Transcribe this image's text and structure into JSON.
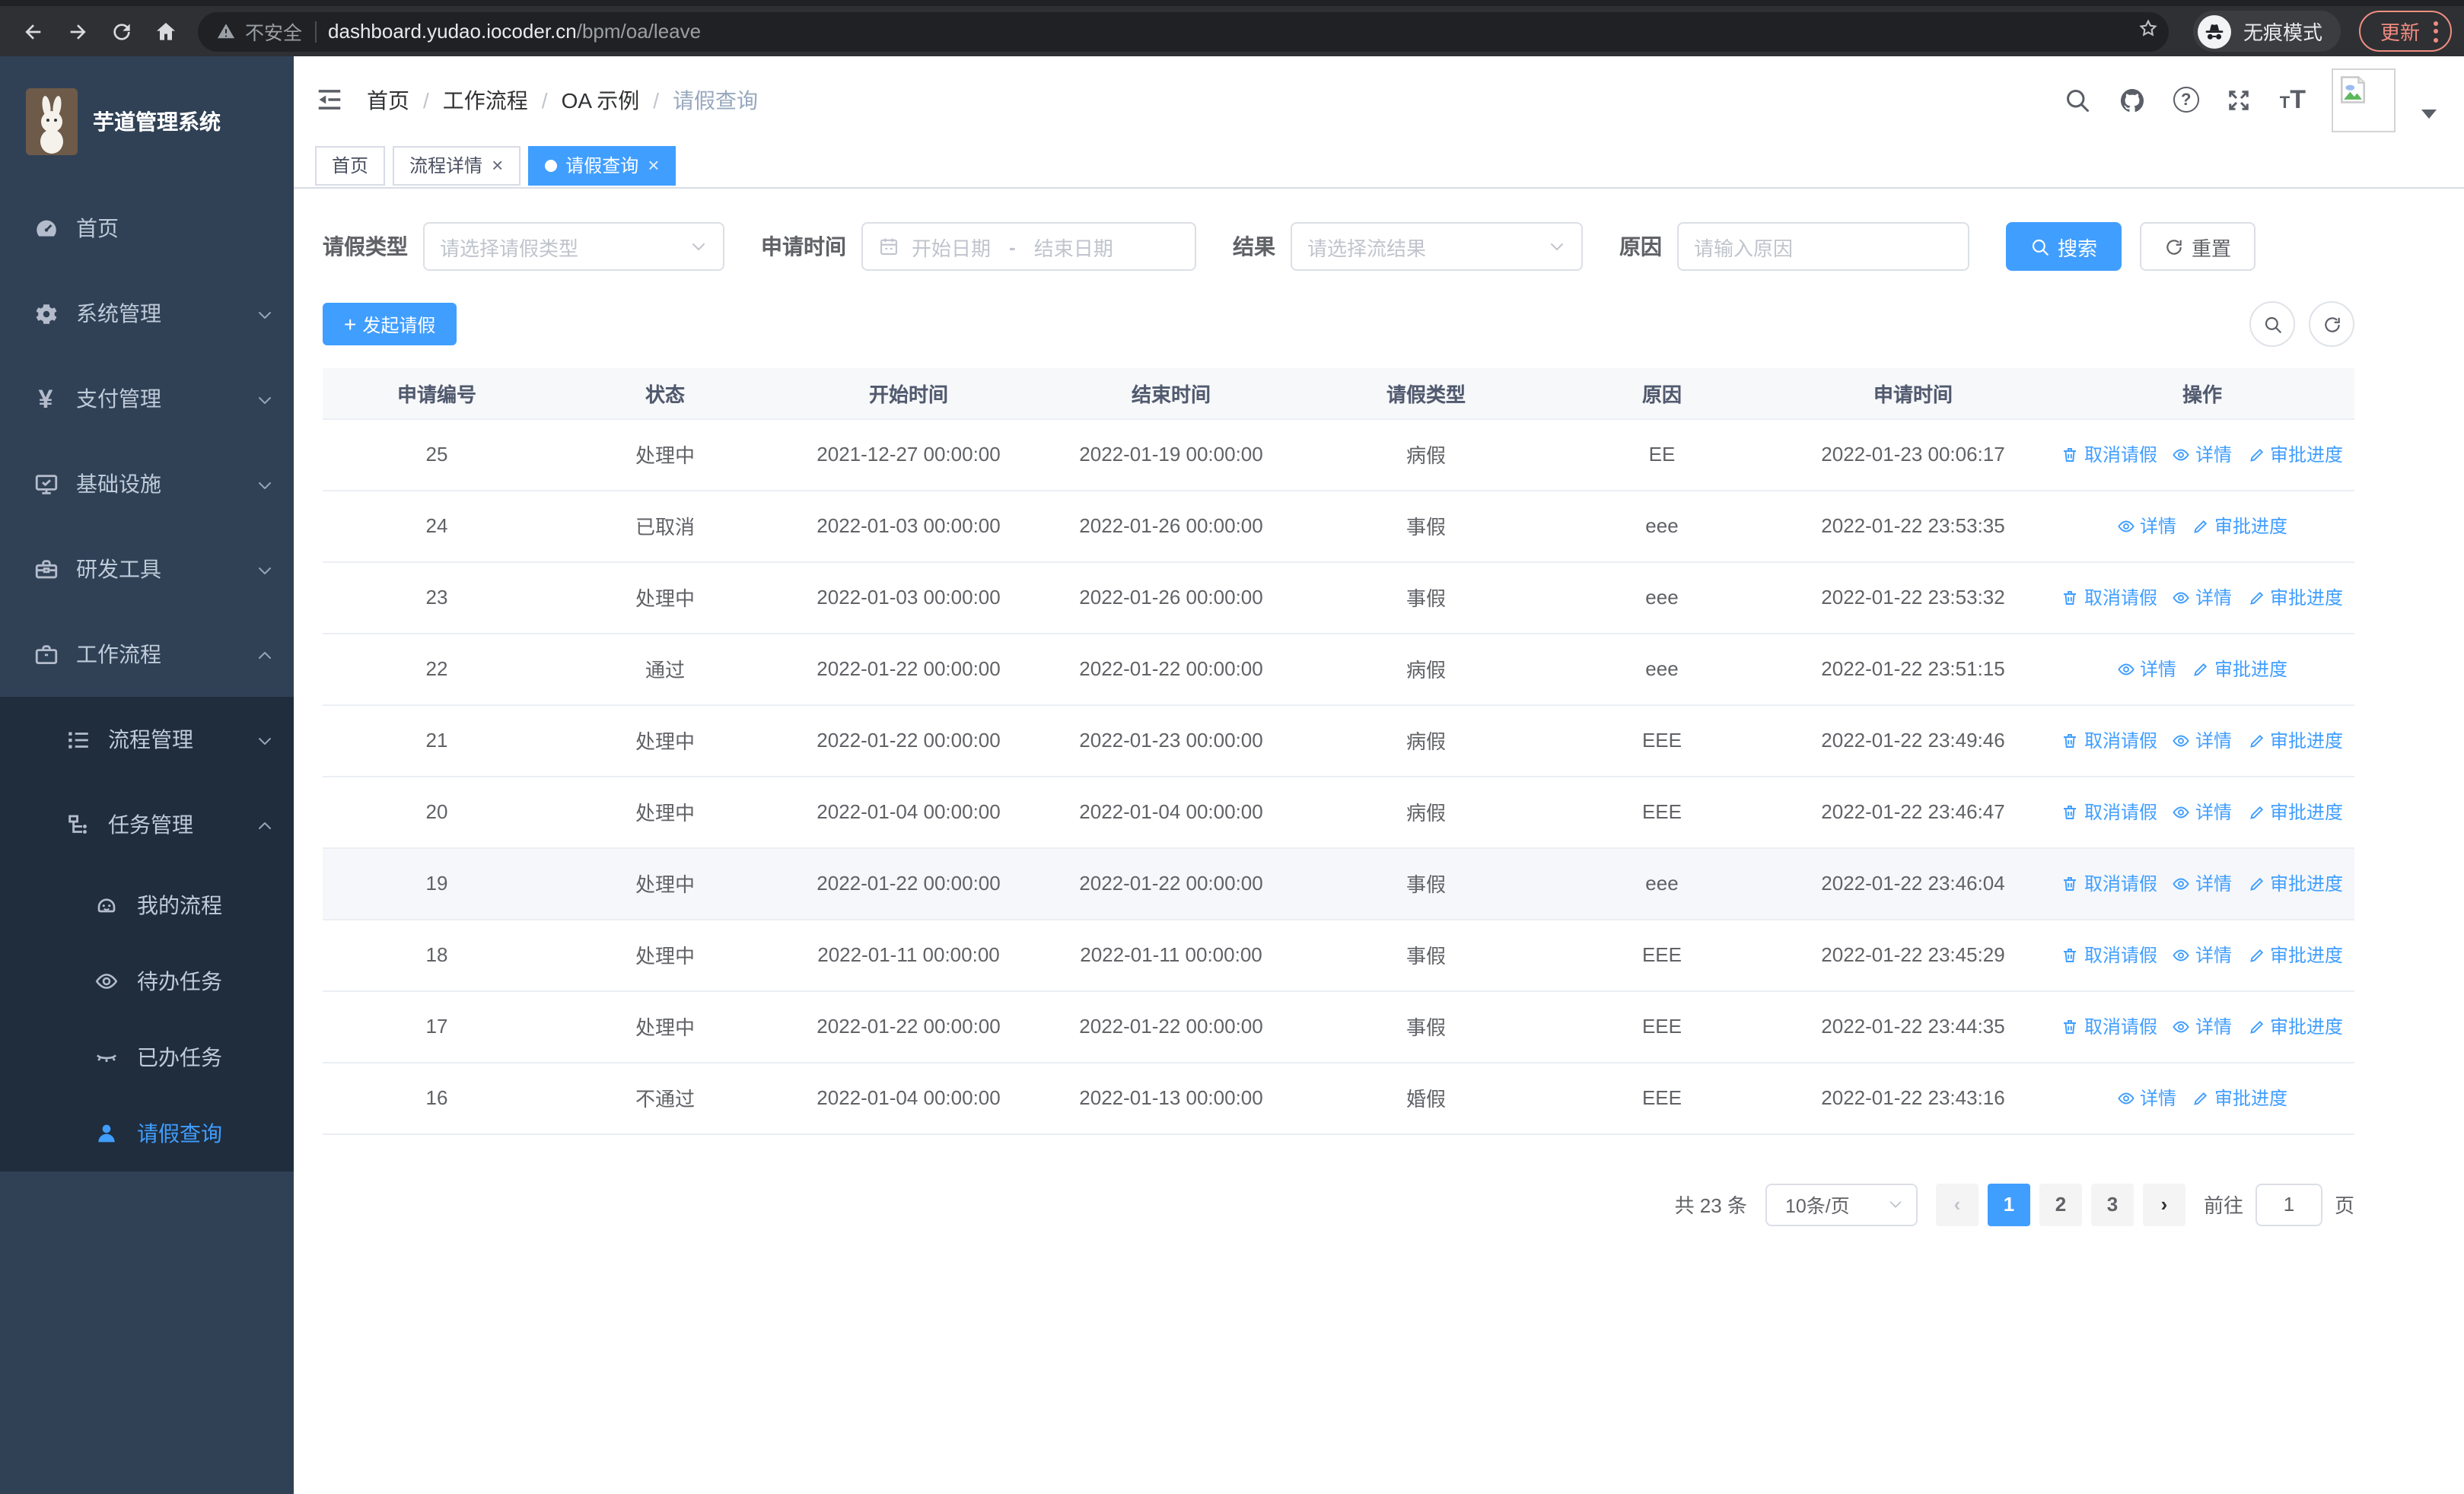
{
  "colors": {
    "primary": "#409EFF",
    "sidebar_bg": "#304156",
    "submenu_bg": "#1f2d3d",
    "update_accent": "#f28b82"
  },
  "browser": {
    "security_label": "不安全",
    "url_host": "dashboard.yudao.iocoder.cn",
    "url_path": "/bpm/oa/leave",
    "incognito_label": "无痕模式",
    "update_label": "更新"
  },
  "sidebar": {
    "app_title": "芋道管理系统",
    "menu": [
      {
        "label": "首页",
        "icon": "dashboard-icon"
      },
      {
        "label": "系统管理",
        "icon": "gear-icon",
        "chevron": "down"
      },
      {
        "label": "支付管理",
        "icon": "yen-icon",
        "chevron": "down"
      },
      {
        "label": "基础设施",
        "icon": "monitor-icon",
        "chevron": "down"
      },
      {
        "label": "研发工具",
        "icon": "toolbox-icon",
        "chevron": "down"
      },
      {
        "label": "工作流程",
        "icon": "briefcase-icon",
        "chevron": "up"
      }
    ],
    "submenu": [
      {
        "label": "流程管理",
        "icon": "list-tree-icon",
        "chevron": "down"
      },
      {
        "label": "任务管理",
        "icon": "flow-tree-icon",
        "chevron": "up"
      }
    ],
    "task_items": [
      {
        "label": "我的流程",
        "icon": "robot-icon"
      },
      {
        "label": "待办任务",
        "icon": "eye-icon"
      },
      {
        "label": "已办任务",
        "icon": "eye-closed-icon"
      },
      {
        "label": "请假查询",
        "icon": "user-icon",
        "active": true
      }
    ]
  },
  "header": {
    "breadcrumb": [
      "首页",
      "工作流程",
      "OA 示例",
      "请假查询"
    ],
    "separator": "/",
    "icons": [
      "search-icon",
      "github-icon",
      "help-icon",
      "fullscreen-icon",
      "font-size-icon",
      "avatar",
      "caret-down-icon"
    ]
  },
  "tabs": [
    {
      "label": "首页"
    },
    {
      "label": "流程详情",
      "close": "×"
    },
    {
      "label": "请假查询",
      "close": "×",
      "active": true
    }
  ],
  "filters": {
    "leave_type_label": "请假类型",
    "leave_type_placeholder": "请选择请假类型",
    "apply_time_label": "申请时间",
    "date_start_placeholder": "开始日期",
    "date_separator": "-",
    "date_end_placeholder": "结束日期",
    "result_label": "结果",
    "result_placeholder": "请选择流结果",
    "reason_label": "原因",
    "reason_placeholder": "请输入原因",
    "search_label": "搜索",
    "reset_label": "重置"
  },
  "toolbar": {
    "create_label": "发起请假"
  },
  "table": {
    "columns": [
      "申请编号",
      "状态",
      "开始时间",
      "结束时间",
      "请假类型",
      "原因",
      "申请时间",
      "操作"
    ],
    "rows": [
      {
        "id": "25",
        "status": "处理中",
        "start": "2021-12-27 00:00:00",
        "end": "2022-01-19 00:00:00",
        "type": "病假",
        "reason": "EE",
        "apply_time": "2022-01-23 00:06:17",
        "actions": {
          "cancel": "取消请假",
          "detail": "详情",
          "progress": "审批进度"
        }
      },
      {
        "id": "24",
        "status": "已取消",
        "start": "2022-01-03 00:00:00",
        "end": "2022-01-26 00:00:00",
        "type": "事假",
        "reason": "eee",
        "apply_time": "2022-01-22 23:53:35",
        "actions": {
          "detail": "详情",
          "progress": "审批进度"
        }
      },
      {
        "id": "23",
        "status": "处理中",
        "start": "2022-01-03 00:00:00",
        "end": "2022-01-26 00:00:00",
        "type": "事假",
        "reason": "eee",
        "apply_time": "2022-01-22 23:53:32",
        "actions": {
          "cancel": "取消请假",
          "detail": "详情",
          "progress": "审批进度"
        }
      },
      {
        "id": "22",
        "status": "通过",
        "start": "2022-01-22 00:00:00",
        "end": "2022-01-22 00:00:00",
        "type": "病假",
        "reason": "eee",
        "apply_time": "2022-01-22 23:51:15",
        "actions": {
          "detail": "详情",
          "progress": "审批进度"
        }
      },
      {
        "id": "21",
        "status": "处理中",
        "start": "2022-01-22 00:00:00",
        "end": "2022-01-23 00:00:00",
        "type": "病假",
        "reason": "EEE",
        "apply_time": "2022-01-22 23:49:46",
        "actions": {
          "cancel": "取消请假",
          "detail": "详情",
          "progress": "审批进度"
        }
      },
      {
        "id": "20",
        "status": "处理中",
        "start": "2022-01-04 00:00:00",
        "end": "2022-01-04 00:00:00",
        "type": "病假",
        "reason": "EEE",
        "apply_time": "2022-01-22 23:46:47",
        "actions": {
          "cancel": "取消请假",
          "detail": "详情",
          "progress": "审批进度"
        }
      },
      {
        "id": "19",
        "status": "处理中",
        "start": "2022-01-22 00:00:00",
        "end": "2022-01-22 00:00:00",
        "type": "事假",
        "reason": "eee",
        "apply_time": "2022-01-22 23:46:04",
        "highlighted": true,
        "actions": {
          "cancel": "取消请假",
          "detail": "详情",
          "progress": "审批进度"
        }
      },
      {
        "id": "18",
        "status": "处理中",
        "start": "2022-01-11 00:00:00",
        "end": "2022-01-11 00:00:00",
        "type": "事假",
        "reason": "EEE",
        "apply_time": "2022-01-22 23:45:29",
        "actions": {
          "cancel": "取消请假",
          "detail": "详情",
          "progress": "审批进度"
        }
      },
      {
        "id": "17",
        "status": "处理中",
        "start": "2022-01-22 00:00:00",
        "end": "2022-01-22 00:00:00",
        "type": "事假",
        "reason": "EEE",
        "apply_time": "2022-01-22 23:44:35",
        "actions": {
          "cancel": "取消请假",
          "detail": "详情",
          "progress": "审批进度"
        }
      },
      {
        "id": "16",
        "status": "不通过",
        "start": "2022-01-04 00:00:00",
        "end": "2022-01-13 00:00:00",
        "type": "婚假",
        "reason": "EEE",
        "apply_time": "2022-01-22 23:43:16",
        "actions": {
          "detail": "详情",
          "progress": "审批进度"
        }
      }
    ]
  },
  "pagination": {
    "total_label": "共 23 条",
    "page_size": "10条/页",
    "prev": "‹",
    "pages": [
      "1",
      "2",
      "3"
    ],
    "active_page": "1",
    "next": "›",
    "goto_label": "前往",
    "goto_value": "1",
    "unit_label": "页"
  }
}
